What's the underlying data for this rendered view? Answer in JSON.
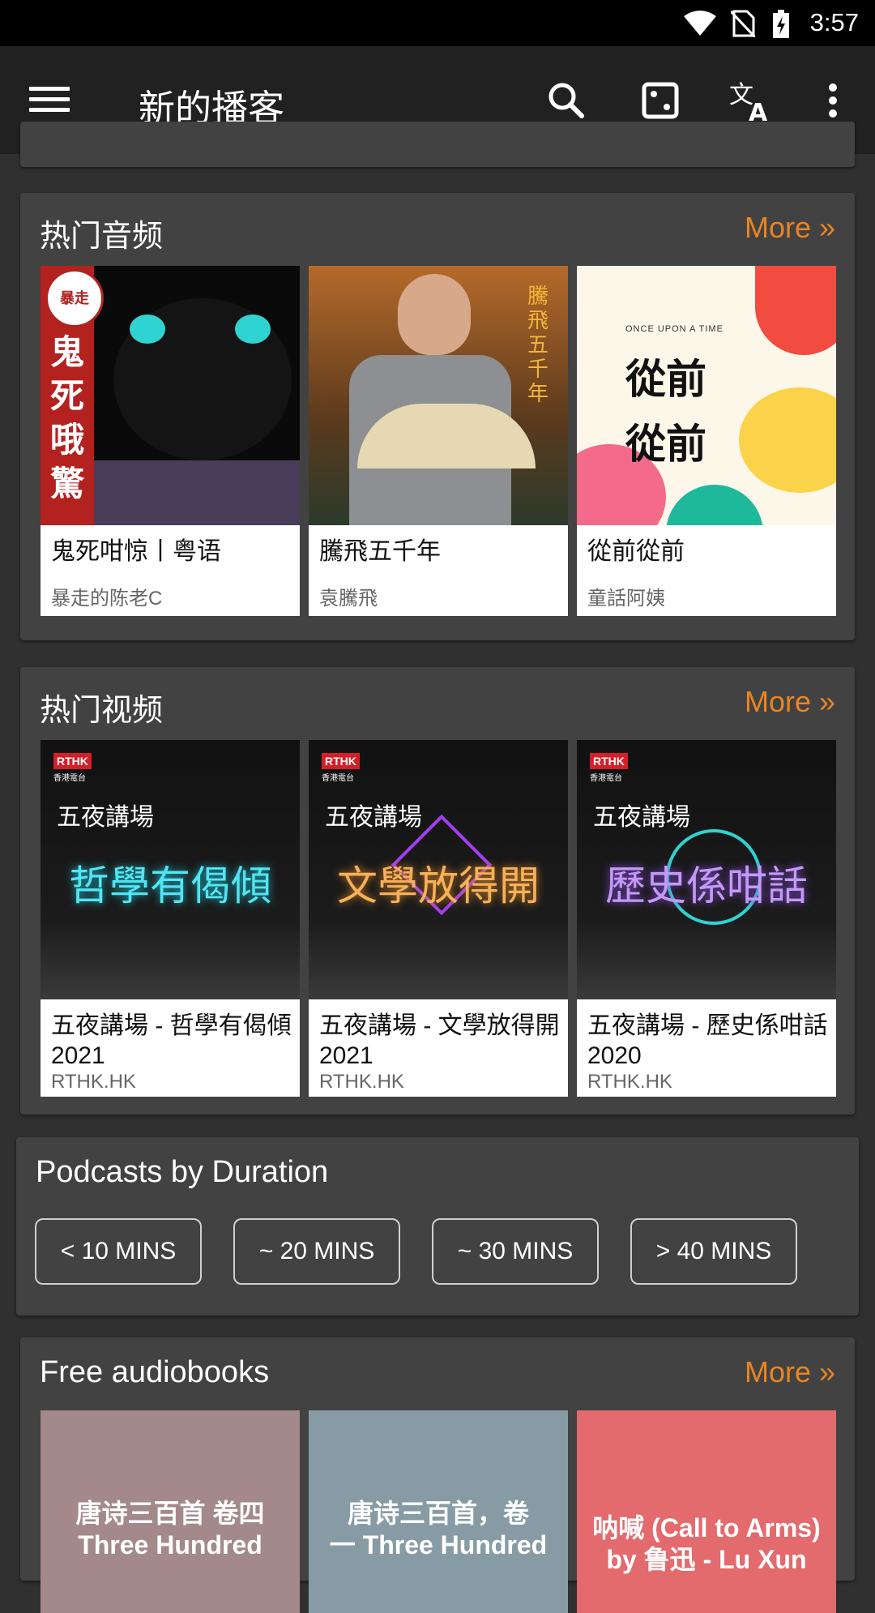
{
  "status_bar": {
    "time": "3:57"
  },
  "toolbar": {
    "title": "新的播客"
  },
  "popular_audio": {
    "title": "热门音频",
    "more": "More »",
    "items": [
      {
        "title": "鬼死咁惊丨粤语",
        "author": "暴走的陈老C",
        "art_badge": "暴走",
        "art_text": "鬼死哦驚"
      },
      {
        "title": "騰飛五千年",
        "author": "袁騰飛",
        "art_text": "騰飛五千年"
      },
      {
        "title": "從前從前",
        "author": "童話阿姨",
        "art_small": "ONCE UPON A TIME",
        "art_text": "從前 從前"
      }
    ]
  },
  "popular_video": {
    "title": "热门视频",
    "more": "More »",
    "items": [
      {
        "title": "五夜講場 - 哲學有偈傾 2021",
        "author": "RTHK.HK",
        "art_logo": "RTHK",
        "art_logo_sub": "香港電台",
        "art_series": "五夜講場",
        "art_text": "哲學有偈傾"
      },
      {
        "title": "五夜講場 - 文學放得開 2021",
        "author": "RTHK.HK",
        "art_logo": "RTHK",
        "art_logo_sub": "香港電台",
        "art_series": "五夜講場",
        "art_text": "文學放得開"
      },
      {
        "title": "五夜講場 - 歷史係咁話 2020",
        "author": "RTHK.HK",
        "art_logo": "RTHK",
        "art_logo_sub": "香港電台",
        "art_series": "五夜講場",
        "art_text": "歷史係咁話"
      }
    ]
  },
  "duration": {
    "title": "Podcasts by Duration",
    "buttons": [
      "< 10 MINS",
      "~ 20 MINS",
      "~ 30 MINS",
      "> 40 MINS"
    ]
  },
  "audiobooks": {
    "title": "Free audiobooks",
    "more": "More »",
    "items": [
      {
        "line1": "唐诗三百首 卷四",
        "line2": "Three Hundred"
      },
      {
        "line1": "唐诗三百首，卷",
        "line2": "一 Three Hundred"
      },
      {
        "line1": "呐喊 (Call to Arms)",
        "line2": "by 鲁迅 - Lu Xun"
      }
    ]
  },
  "colors": {
    "accent": "#e98522",
    "card": "#424242",
    "background": "#303030",
    "toolbar": "#212121"
  }
}
